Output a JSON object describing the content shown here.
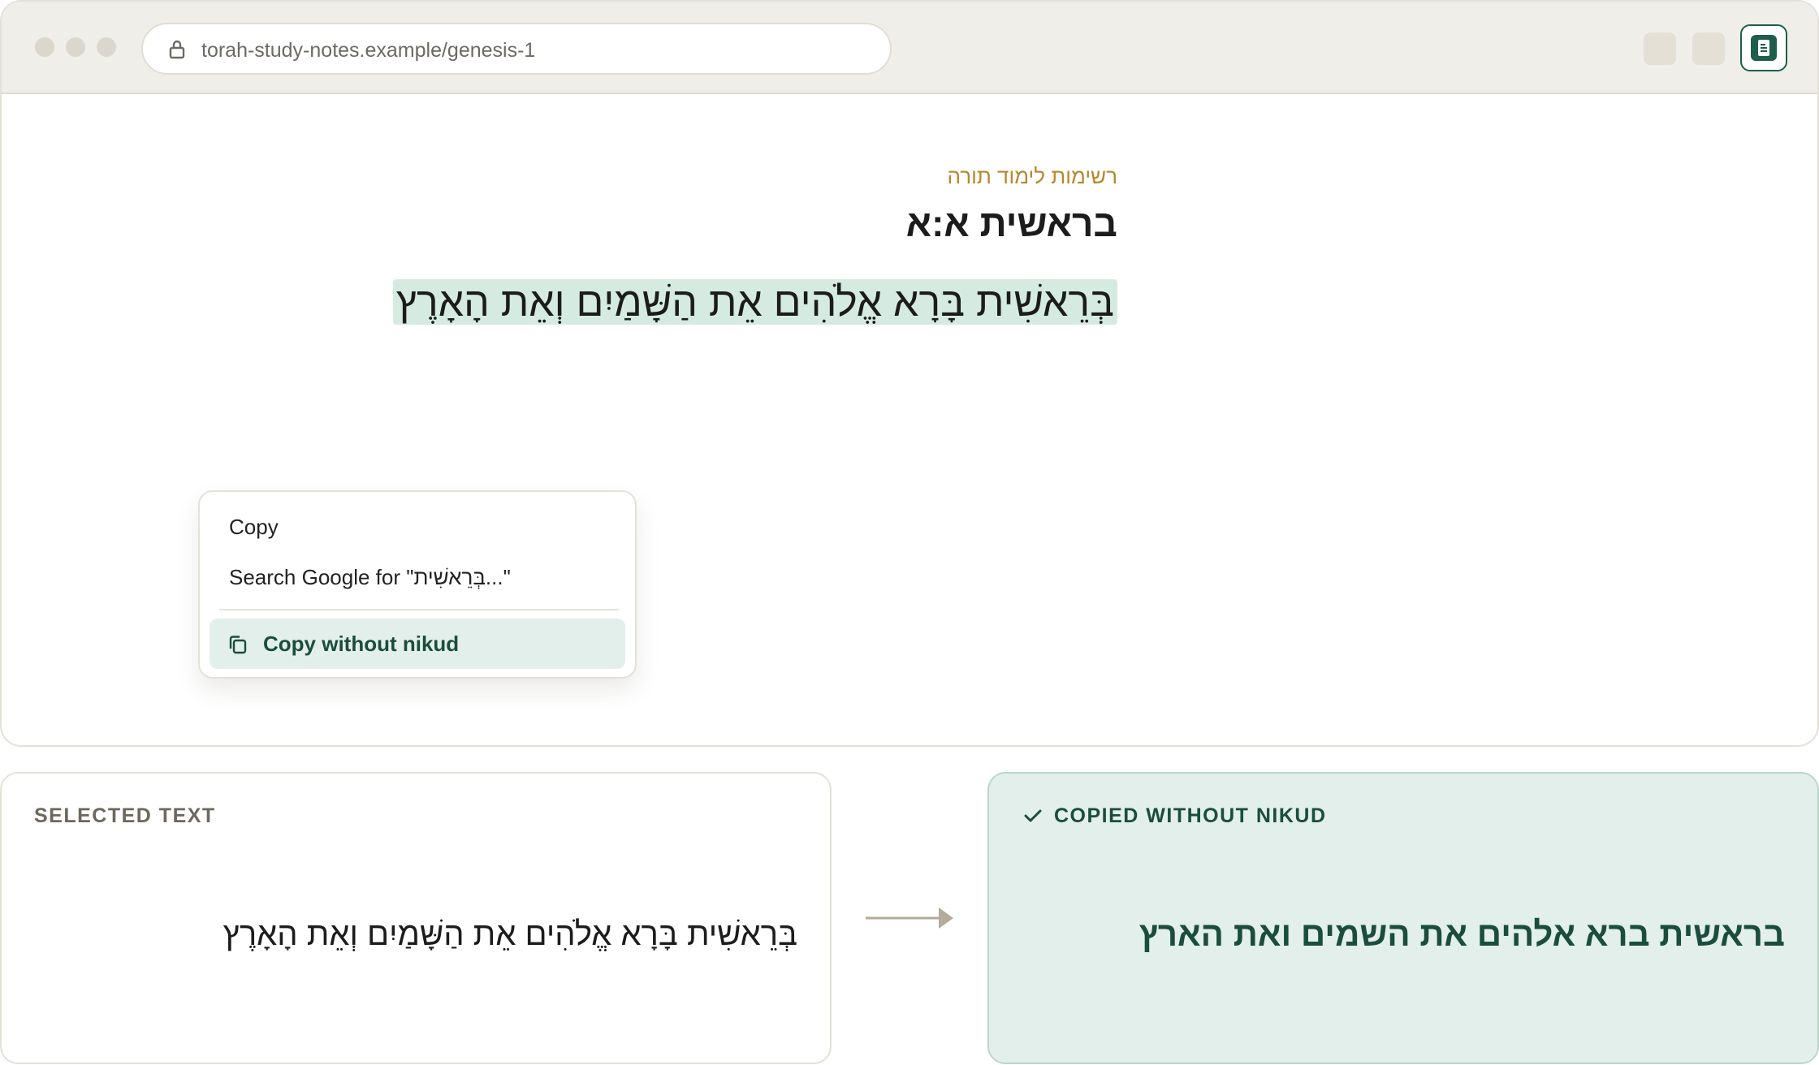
{
  "browser": {
    "url": "torah-study-notes.example/genesis-1",
    "extension_icon": "document-icon"
  },
  "page": {
    "label": "רשימות לימוד תורה",
    "title": "בראשית א:א",
    "verse": "בְּרֵאשִׁית בָּרָא אֱלֹהִים אֵת הַשָּׁמַיִם וְאֵת הָאָרֶץ"
  },
  "context_menu": {
    "copy": "Copy",
    "search": "Search Google for \"בְּרֵאשִׁית...\"",
    "copy_without_nikud": "Copy without nikud"
  },
  "selected_panel": {
    "heading": "SELECTED TEXT",
    "text": "בְּרֵאשִׁית בָּרָא אֱלֹהִים אֵת הַשָּׁמַיִם וְאֵת הָאָרֶץ"
  },
  "copied_panel": {
    "heading": "COPIED WITHOUT NIKUD",
    "text": "בראשית ברא אלהים את השמים ואת הארץ"
  },
  "colors": {
    "accent": "#1f5e4d",
    "highlight": "#d5ebe1",
    "label": "#b8862b",
    "panel_success_bg": "#e3efea"
  }
}
